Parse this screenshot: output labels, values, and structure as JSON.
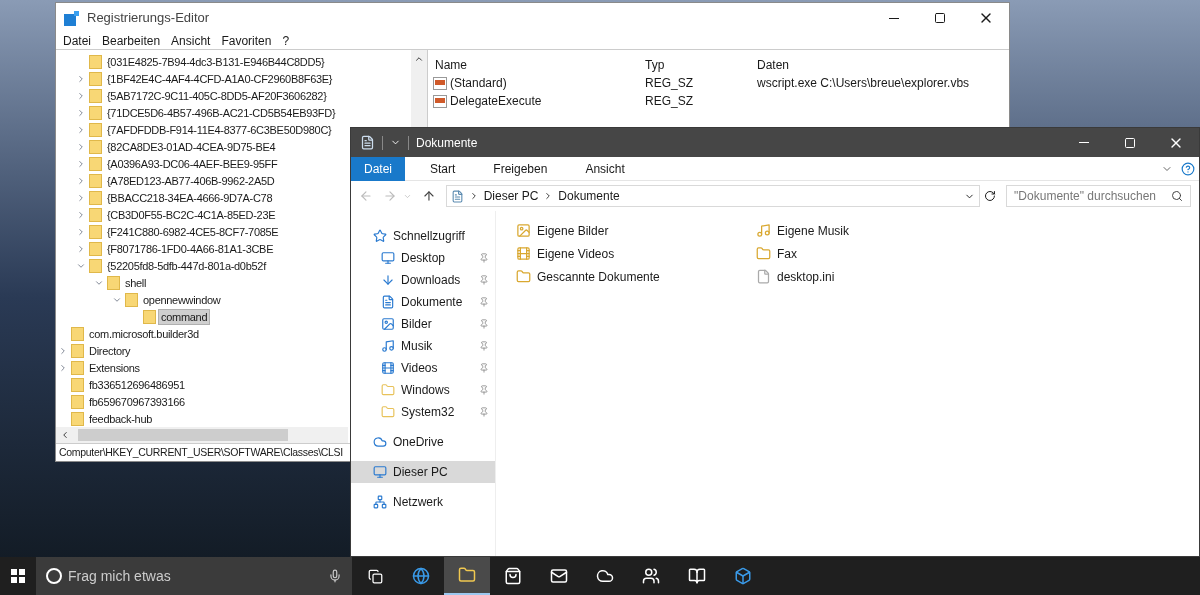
{
  "registry": {
    "title": "Registrierungs-Editor",
    "menu": [
      "Datei",
      "Bearbeiten",
      "Ansicht",
      "Favoriten",
      "?"
    ],
    "tree": [
      {
        "children": [
          {
            "label": "{031E4825-7B94-4dc3-B131-E946B44C8DD5}",
            "selected": false
          },
          {
            "label": "{1BF42E4C-4AF4-4CFD-A1A0-CF2960B8F63E}",
            "expanded": false,
            "selected": false
          },
          {
            "label": "{5AB7172C-9C11-405C-8DD5-AF20F3606282}",
            "expanded": false,
            "selected": false
          },
          {
            "label": "{71DCE5D6-4B57-496B-AC21-CD5B54EB93FD}",
            "expanded": false,
            "selected": false
          },
          {
            "label": "{7AFDFDDB-F914-11E4-8377-6C3BE50D980C}",
            "expanded": false,
            "selected": false
          },
          {
            "label": "{82CA8DE3-01AD-4CEA-9D75-BE4",
            "expanded": false,
            "selected": false
          },
          {
            "label": "{A0396A93-DC06-4AEF-BEE9-95FF",
            "expanded": false,
            "selected": false
          },
          {
            "label": "{A78ED123-AB77-406B-9962-2A5D",
            "expanded": false,
            "selected": false
          },
          {
            "label": "{BBACC218-34EA-4666-9D7A-C78",
            "expanded": false,
            "selected": false
          },
          {
            "label": "{CB3D0F55-BC2C-4C1A-85ED-23E",
            "expanded": false,
            "selected": false
          },
          {
            "label": "{F241C880-6982-4CE5-8CF7-7085E",
            "expanded": false,
            "selected": false
          },
          {
            "label": "{F8071786-1FD0-4A66-81A1-3CBE",
            "expanded": false,
            "selected": false
          },
          {
            "label": "{52205fd8-5dfb-447d-801a-d0b52f",
            "expanded": true,
            "selected": false,
            "children": [
              {
                "label": "shell",
                "expanded": true,
                "selected": false,
                "children": [
                  {
                    "label": "opennewwindow",
                    "expanded": true,
                    "selected": false,
                    "children": [
                      {
                        "label": "command",
                        "selected": true
                      }
                    ]
                  }
                ]
              }
            ]
          }
        ]
      },
      {
        "label": "com.microsoft.builder3d",
        "selected": false
      },
      {
        "label": "Directory",
        "expanded": false,
        "selected": false
      },
      {
        "label": "Extensions",
        "expanded": false,
        "selected": false
      },
      {
        "label": "fb336512696486951",
        "selected": false
      },
      {
        "label": "fb659670967393166",
        "selected": false
      },
      {
        "label": "feedback-hub",
        "selected": false
      }
    ],
    "columns": [
      "Name",
      "Typ",
      "Daten"
    ],
    "values": [
      {
        "name": "(Standard)",
        "type": "REG_SZ",
        "data": "wscript.exe C:\\Users\\breue\\explorer.vbs"
      },
      {
        "name": "DelegateExecute",
        "type": "REG_SZ"
      }
    ],
    "status_bar": "Computer\\HKEY_CURRENT_USER\\SOFTWARE\\Classes\\CLSI"
  },
  "explorer": {
    "title": "Dokumente",
    "ribbon_tabs": [
      {
        "label": "Datei",
        "selected": true
      },
      {
        "label": "Start",
        "selected": false
      },
      {
        "label": "Freigeben",
        "selected": false
      },
      {
        "label": "Ansicht",
        "selected": false
      }
    ],
    "breadcrumb": [
      "Dieser PC",
      "Dokumente"
    ],
    "search": {
      "placeholder": "\"Dokumente\" durchsuchen"
    },
    "nav": [
      {
        "label": "Schnellzugriff",
        "selected": false,
        "children": [
          {
            "label": "Desktop",
            "pinned": true,
            "selected": false
          },
          {
            "label": "Downloads",
            "pinned": true,
            "selected": false
          },
          {
            "label": "Dokumente",
            "pinned": true,
            "selected": false
          },
          {
            "label": "Bilder",
            "pinned": true,
            "selected": false
          },
          {
            "label": "Musik",
            "pinned": true,
            "selected": false
          },
          {
            "label": "Videos",
            "pinned": true,
            "selected": false
          },
          {
            "label": "Windows",
            "pinned": true,
            "selected": false
          },
          {
            "label": "System32",
            "pinned": true,
            "selected": false
          }
        ]
      },
      {
        "label": "OneDrive",
        "selected": false
      },
      {
        "label": "Dieser PC",
        "selected": true
      },
      {
        "label": "Netzwerk",
        "selected": false
      }
    ],
    "files": [
      {
        "label": "Eigene Bilder"
      },
      {
        "label": "Eigene Videos"
      },
      {
        "label": "Gescannte Dokumente"
      },
      {
        "label": "Eigene Musik"
      },
      {
        "label": "Fax"
      },
      {
        "label": "desktop.ini"
      }
    ]
  },
  "taskbar": {
    "search": {
      "placeholder": "Frag mich etwas"
    },
    "apps": [
      {
        "selected": false
      },
      {
        "selected": true
      },
      {
        "selected": false
      },
      {
        "selected": false
      },
      {
        "selected": false
      },
      {
        "selected": false
      },
      {
        "selected": false
      },
      {
        "selected": false
      }
    ]
  }
}
